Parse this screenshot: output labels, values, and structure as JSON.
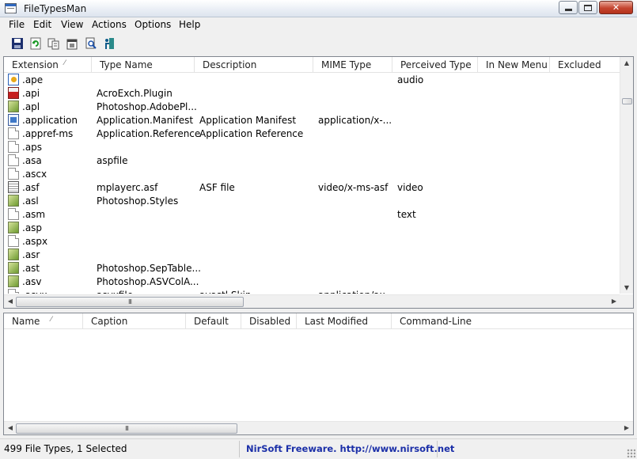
{
  "window": {
    "title": "FileTypesMan"
  },
  "menu": [
    "File",
    "Edit",
    "View",
    "Actions",
    "Options",
    "Help"
  ],
  "toolbar": [
    {
      "name": "save-icon"
    },
    {
      "name": "refresh-icon"
    },
    {
      "name": "copy-icon"
    },
    {
      "name": "properties-icon"
    },
    {
      "name": "find-icon"
    },
    {
      "name": "exit-icon"
    }
  ],
  "top_list": {
    "columns": [
      "Extension",
      "Type Name",
      "Description",
      "MIME Type",
      "Perceived Type",
      "In New Menu",
      "Excluded"
    ],
    "rows": [
      {
        "ext": ".ape",
        "type": "",
        "desc": "",
        "mime": "",
        "perceived": "audio",
        "icon": "ape"
      },
      {
        "ext": ".api",
        "type": "AcroExch.Plugin",
        "desc": "",
        "mime": "",
        "perceived": "",
        "icon": "red"
      },
      {
        "ext": ".apl",
        "type": "Photoshop.AdobePl...",
        "desc": "",
        "mime": "",
        "perceived": "",
        "icon": "green"
      },
      {
        "ext": ".application",
        "type": "Application.Manifest",
        "desc": "Application Manifest",
        "mime": "application/x-...",
        "perceived": "",
        "icon": "blue"
      },
      {
        "ext": ".appref-ms",
        "type": "Application.Reference",
        "desc": "Application Reference",
        "mime": "",
        "perceived": "",
        "icon": "plain"
      },
      {
        "ext": ".aps",
        "type": "",
        "desc": "",
        "mime": "",
        "perceived": "",
        "icon": "plain"
      },
      {
        "ext": ".asa",
        "type": "aspfile",
        "desc": "",
        "mime": "",
        "perceived": "",
        "icon": "plain"
      },
      {
        "ext": ".ascx",
        "type": "",
        "desc": "",
        "mime": "",
        "perceived": "",
        "icon": "plain"
      },
      {
        "ext": ".asf",
        "type": "mplayerc.asf",
        "desc": "ASF file",
        "mime": "video/x-ms-asf",
        "perceived": "video",
        "icon": "asf"
      },
      {
        "ext": ".asl",
        "type": "Photoshop.Styles",
        "desc": "",
        "mime": "",
        "perceived": "",
        "icon": "green"
      },
      {
        "ext": ".asm",
        "type": "",
        "desc": "",
        "mime": "",
        "perceived": "text",
        "icon": "plain"
      },
      {
        "ext": ".asp",
        "type": "",
        "desc": "",
        "mime": "",
        "perceived": "",
        "icon": "green"
      },
      {
        "ext": ".aspx",
        "type": "",
        "desc": "",
        "mime": "",
        "perceived": "",
        "icon": "plain"
      },
      {
        "ext": ".asr",
        "type": "",
        "desc": "",
        "mime": "",
        "perceived": "",
        "icon": "green"
      },
      {
        "ext": ".ast",
        "type": "Photoshop.SepTable...",
        "desc": "",
        "mime": "",
        "perceived": "",
        "icon": "green"
      },
      {
        "ext": ".asv",
        "type": "Photoshop.ASVColA...",
        "desc": "",
        "mime": "",
        "perceived": "",
        "icon": "green"
      },
      {
        "ext": ".asvx",
        "type": "asvxfile",
        "desc": "avastl Skin",
        "mime": "application/ax...",
        "perceived": "",
        "icon": "plain"
      }
    ]
  },
  "bottom_list": {
    "columns": [
      "Name",
      "Caption",
      "Default",
      "Disabled",
      "Last Modified",
      "Command-Line"
    ]
  },
  "status": {
    "count": "499 File Types, 1 Selected",
    "link": "NirSoft Freeware.  http://www.nirsoft.net"
  },
  "scroll": {
    "top_h_thumb": "III",
    "bottom_h_thumb": "III"
  }
}
